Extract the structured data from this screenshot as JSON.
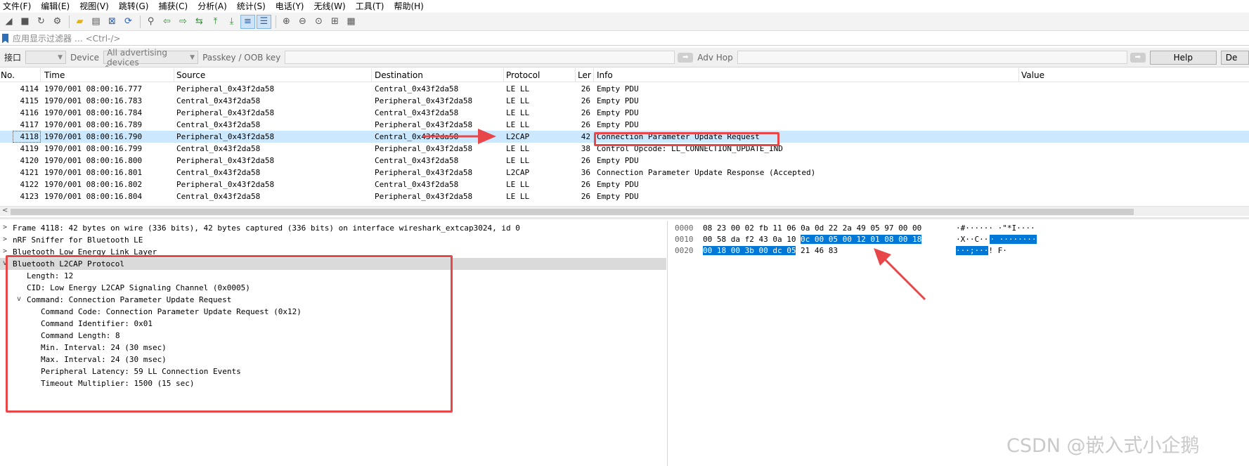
{
  "menu": [
    "文件(F)",
    "编辑(E)",
    "视图(V)",
    "跳转(G)",
    "捕获(C)",
    "分析(A)",
    "统计(S)",
    "电话(Y)",
    "无线(W)",
    "工具(T)",
    "帮助(H)"
  ],
  "filter": {
    "placeholder": "应用显示过滤器 … <Ctrl-/>"
  },
  "interface_bar": {
    "interface_label": "接口",
    "device_label": "Device",
    "device_value": "All advertising devices",
    "passkey_label": "Passkey / OOB key",
    "advhop_label": "Adv Hop",
    "help_label": "Help",
    "de_label": "De"
  },
  "columns": {
    "no": "No.",
    "time": "Time",
    "source": "Source",
    "destination": "Destination",
    "protocol": "Protocol",
    "len": "Ler",
    "info": "Info",
    "value": "Value"
  },
  "packets": [
    {
      "no": "4114",
      "time": "1970/001 08:00:16.777",
      "source": "Peripheral_0x43f2da58",
      "destination": "Central_0x43f2da58",
      "protocol": "LE LL",
      "len": "26",
      "info": "Empty PDU"
    },
    {
      "no": "4115",
      "time": "1970/001 08:00:16.783",
      "source": "Central_0x43f2da58",
      "destination": "Peripheral_0x43f2da58",
      "protocol": "LE LL",
      "len": "26",
      "info": "Empty PDU"
    },
    {
      "no": "4116",
      "time": "1970/001 08:00:16.784",
      "source": "Peripheral_0x43f2da58",
      "destination": "Central_0x43f2da58",
      "protocol": "LE LL",
      "len": "26",
      "info": "Empty PDU"
    },
    {
      "no": "4117",
      "time": "1970/001 08:00:16.789",
      "source": "Central_0x43f2da58",
      "destination": "Peripheral_0x43f2da58",
      "protocol": "LE LL",
      "len": "26",
      "info": "Empty PDU"
    },
    {
      "no": "4118",
      "time": "1970/001 08:00:16.790",
      "source": "Peripheral_0x43f2da58",
      "destination": "Central_0x43f2da58",
      "protocol": "L2CAP",
      "len": "42",
      "info": "Connection Parameter Update Request"
    },
    {
      "no": "4119",
      "time": "1970/001 08:00:16.799",
      "source": "Central_0x43f2da58",
      "destination": "Peripheral_0x43f2da58",
      "protocol": "LE LL",
      "len": "38",
      "info": "Control Opcode: LL_CONNECTION_UPDATE_IND"
    },
    {
      "no": "4120",
      "time": "1970/001 08:00:16.800",
      "source": "Peripheral_0x43f2da58",
      "destination": "Central_0x43f2da58",
      "protocol": "LE LL",
      "len": "26",
      "info": "Empty PDU"
    },
    {
      "no": "4121",
      "time": "1970/001 08:00:16.801",
      "source": "Central_0x43f2da58",
      "destination": "Peripheral_0x43f2da58",
      "protocol": "L2CAP",
      "len": "36",
      "info": "Connection Parameter Update Response (Accepted)"
    },
    {
      "no": "4122",
      "time": "1970/001 08:00:16.802",
      "source": "Peripheral_0x43f2da58",
      "destination": "Central_0x43f2da58",
      "protocol": "LE LL",
      "len": "26",
      "info": "Empty PDU"
    },
    {
      "no": "4123",
      "time": "1970/001 08:00:16.804",
      "source": "Central_0x43f2da58",
      "destination": "Peripheral_0x43f2da58",
      "protocol": "LE LL",
      "len": "26",
      "info": "Empty PDU"
    }
  ],
  "selected_packet": "4118",
  "details": [
    {
      "text": "Frame 4118: 42 bytes on wire (336 bits), 42 bytes captured (336 bits) on interface wireshark_extcap3024, id 0",
      "expander": ">"
    },
    {
      "text": "nRF Sniffer for Bluetooth LE",
      "expander": ">"
    },
    {
      "text": "Bluetooth Low Energy Link Layer",
      "expander": ">"
    },
    {
      "text": "Bluetooth L2CAP Protocol",
      "expander": "v"
    },
    {
      "text": "Length: 12",
      "expander": ""
    },
    {
      "text": "CID: Low Energy L2CAP Signaling Channel (0x0005)",
      "expander": ""
    },
    {
      "text": "Command: Connection Parameter Update Request",
      "expander": "v"
    },
    {
      "text": "Command Code: Connection Parameter Update Request (0x12)",
      "expander": ""
    },
    {
      "text": "Command Identifier: 0x01",
      "expander": ""
    },
    {
      "text": "Command Length: 8",
      "expander": ""
    },
    {
      "text": "Min. Interval: 24 (30 msec)",
      "expander": ""
    },
    {
      "text": "Max. Interval: 24 (30 msec)",
      "expander": ""
    },
    {
      "text": "Peripheral Latency: 59 LL Connection Events",
      "expander": ""
    },
    {
      "text": "Timeout Multiplier: 1500 (15 sec)",
      "expander": ""
    }
  ],
  "bytes": [
    {
      "offset": "0000",
      "hex_plain": "08 23 00 02 fb 11 06 0a  0d 22 2a 49 05 97 00 00",
      "hex_hl": "",
      "hex_after": "",
      "ascii_plain": "·#······ ·\"*I····",
      "ascii_hl": "",
      "ascii_after": ""
    },
    {
      "offset": "0010",
      "hex_plain": "00 58 da f2 43 0a 10",
      "hex_hl": "0c  00 05 00 12 01 08 00 18",
      "hex_after": "",
      "ascii_plain": "·X··C··",
      "ascii_hl": "· ········",
      "ascii_after": ""
    },
    {
      "offset": "0020",
      "hex_plain": "",
      "hex_hl": "00 18 00 3b 00 dc 05",
      "hex_after": "21  46 83",
      "ascii_plain": "",
      "ascii_hl": "···;···",
      "ascii_after": "! F·"
    }
  ],
  "watermark": "CSDN @嵌入式小企鹅",
  "colors": {
    "selection": "#cce8ff",
    "byte_highlight": "#0078d7",
    "annotation": "#e8474a"
  }
}
